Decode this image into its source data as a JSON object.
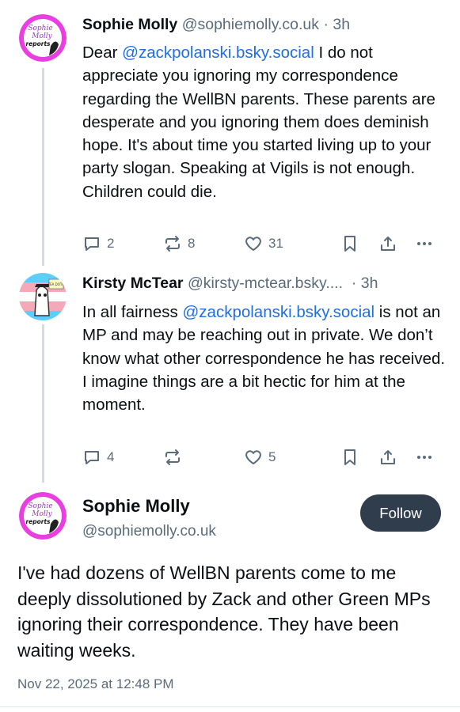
{
  "replies": [
    {
      "display_name": "Sophie Molly",
      "handle": "@sophiemolly.co.uk",
      "time": "3h",
      "text_before": "Dear ",
      "mention": "@zackpolanski.bsky.social",
      "text_after": " I do not appreciate you ignoring my correspondence regarding the WellBN parents. These parents are desperate and you ignoring them does deminish hope. It's about time you started living up to your party slogan. Speaking at Vigils is not enough. Children could die.",
      "reply_count": "2",
      "repost_count": "8",
      "like_count": "31",
      "avatar_text": [
        "Sophie",
        "Molly",
        "reports"
      ]
    },
    {
      "display_name": "Kirsty McTear",
      "handle": "@kirsty-mctear.bsky....",
      "time": "3h",
      "text_before": "In all fairness ",
      "mention": "@zackpolanski.bsky.social",
      "text_after": " is not an MP and may be reaching out in private. We don’t know what other correspondence he has received. I imagine things are a bit hectic for him at the moment.",
      "reply_count": "4",
      "repost_count": "",
      "like_count": "5",
      "avatar_sign": "TEA DOTH"
    }
  ],
  "main_post": {
    "display_name": "Sophie Molly",
    "handle": "@sophiemolly.co.uk",
    "follow_label": "Follow",
    "text": "I've had dozens of WellBN parents come to me deeply dissolutioned by Zack and other Green MPs ignoring their correspondence. They have been waiting weeks.",
    "timestamp": "Nov 22, 2025 at 12:48 PM",
    "avatar_text": [
      "Sophie",
      "Molly",
      "reports"
    ]
  },
  "colors": {
    "accent_link": "#1d6fe3",
    "muted": "#5b6b7a",
    "follow_bg": "#2f3d4c",
    "thread_line": "#d4dbe2",
    "avatar_ring": "#e93fe0"
  },
  "icons": [
    "reply-icon",
    "repost-icon",
    "like-icon",
    "bookmark-icon",
    "share-icon",
    "more-icon"
  ]
}
